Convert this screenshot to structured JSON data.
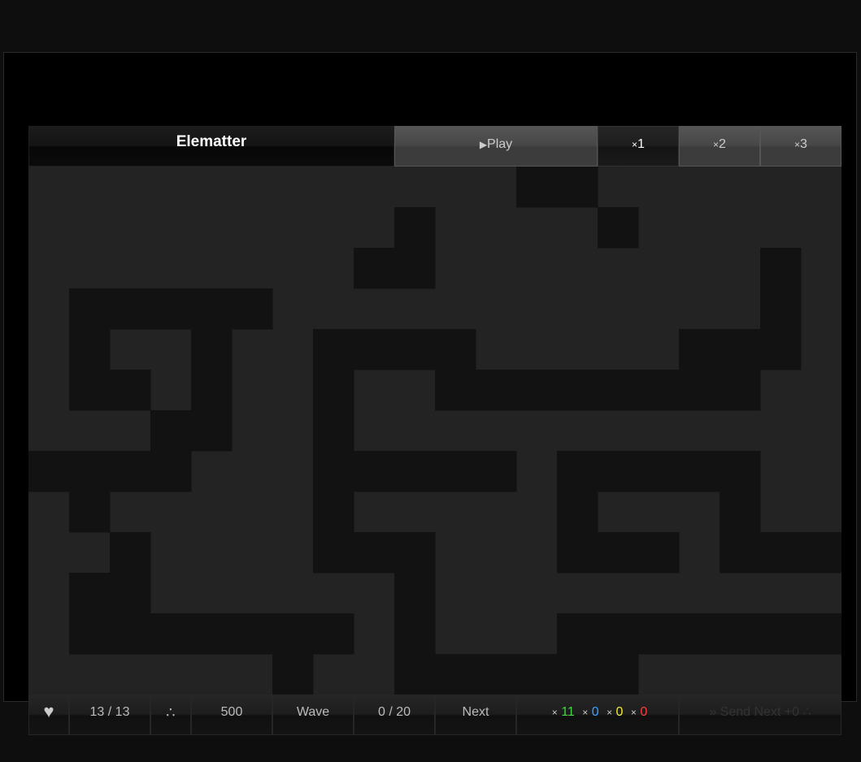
{
  "header": {
    "title": "Elematter",
    "play_icon": "play-triangle-icon",
    "play_label": "Play",
    "speed_buttons": [
      {
        "prefix": "×",
        "label": "1",
        "active": true
      },
      {
        "prefix": "×",
        "label": "2",
        "active": false
      },
      {
        "prefix": "×",
        "label": "3",
        "active": false
      }
    ]
  },
  "status": {
    "lives_icon": "♥",
    "lives": "13 / 13",
    "gold_icon": "∴",
    "gold": "500",
    "wave_label": "Wave",
    "wave": "0 / 20",
    "next_label": "Next",
    "elements": [
      {
        "prefix": "×",
        "value": "11",
        "color": "#44d644"
      },
      {
        "prefix": "×",
        "value": "0",
        "color": "#3aa0ff"
      },
      {
        "prefix": "×",
        "value": "0",
        "color": "#eeee33"
      },
      {
        "prefix": "×",
        "value": "0",
        "color": "#ff3b3b"
      }
    ],
    "send_next_label": "» Send Next +0 ∴"
  },
  "maze": {
    "path_color": "#121212",
    "ground_color": "#232323",
    "grid": [
      "............##......",
      ".........#....#.....",
      "........##........#.",
      ".#####............#.",
      ".#..#..####.....###.",
      ".##.#..#..########..",
      "...##..#............",
      "####...#####.#####..",
      ".#.....#.....#...#..",
      "..#....###...###.###",
      ".##......#..........",
      ".#######.#...#######",
      "......#..######....."
    ]
  }
}
